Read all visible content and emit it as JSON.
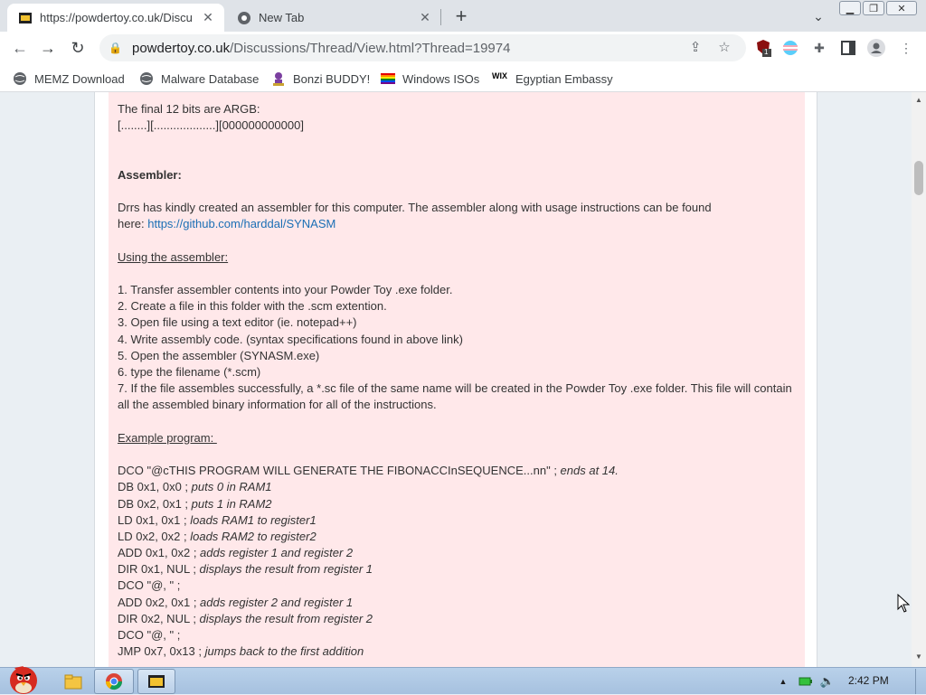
{
  "browser": {
    "tabs": [
      {
        "title": "https://powdertoy.co.uk/Discu",
        "active": true
      },
      {
        "title": "New Tab",
        "active": false
      }
    ],
    "address": {
      "host": "powdertoy.co.uk",
      "path": "/Discussions/Thread/View.html?Thread=19974"
    },
    "extension_badge": "1",
    "bookmarks": [
      {
        "label": "MEMZ Download",
        "icon": "globe-icon"
      },
      {
        "label": "Malware Database",
        "icon": "globe-icon"
      },
      {
        "label": "Bonzi BUDDY!",
        "icon": "bonzi-icon"
      },
      {
        "label": "Windows ISOs",
        "icon": "rainbow-flag-icon"
      },
      {
        "label": "Egyptian Embassy",
        "icon": "wix-icon"
      }
    ]
  },
  "post": {
    "argb_heading": "The final 12 bits are ARGB:",
    "argb_pattern": "[........][...................][000000000000]",
    "assembler_heading": "Assembler:",
    "assembler_desc_1": "Drrs has kindly created an assembler for this computer. The assembler along with usage instructions can be found",
    "assembler_desc_2": "here: ",
    "assembler_link": "https://github.com/harddal/SYNASM",
    "using_heading": "Using the assembler:",
    "steps": [
      "1. Transfer assembler contents into your Powder Toy .exe folder.",
      "2. Create a file in this folder with the .scm extention.",
      "3. Open file using a text editor (ie. notepad++)",
      "4. Write assembly code. (syntax specifications found in above link)",
      "5. Open the assembler (SYNASM.exe)",
      "6. type the filename (*.scm)",
      "7. If the file assembles successfully, a *.sc file of the same name will be created in the Powder Toy .exe folder. This file will contain",
      "all the assembled binary information for all of the instructions."
    ],
    "example_heading": "Example program: ",
    "code": [
      {
        "code": "DCO \"@cTHIS PROGRAM WILL GENERATE THE FIBONACCInSEQUENCE...nn\" ; ",
        "comment": "ends at 14."
      },
      {
        "code": "DB 0x1, 0x0 ; ",
        "comment": "puts 0 in RAM1"
      },
      {
        "code": "DB 0x2, 0x1 ; ",
        "comment": "puts 1 in RAM2"
      },
      {
        "code": "LD 0x1, 0x1 ; ",
        "comment": "loads RAM1 to register1"
      },
      {
        "code": "LD 0x2, 0x2 ; ",
        "comment": "loads RAM2 to register2"
      },
      {
        "code": "ADD 0x1, 0x2 ; ",
        "comment": "adds register 1 and register 2"
      },
      {
        "code": "DIR 0x1, NUL ; ",
        "comment": "displays the result from register 1"
      },
      {
        "code": "DCO \"@, \" ;",
        "comment": ""
      },
      {
        "code": "ADD 0x2, 0x1 ; ",
        "comment": "adds register 2 and register 1"
      },
      {
        "code": "DIR 0x2, NUL ; ",
        "comment": "displays the result from register 2"
      },
      {
        "code": "DCO \"@, \" ;",
        "comment": ""
      },
      {
        "code": "JMP 0x7, 0x13 ; ",
        "comment": "jumps back to the first addition"
      }
    ]
  },
  "taskbar": {
    "clock": "2:42 PM"
  },
  "colors": {
    "post_background": "#ffe8ea",
    "link": "#1a6fb5"
  }
}
